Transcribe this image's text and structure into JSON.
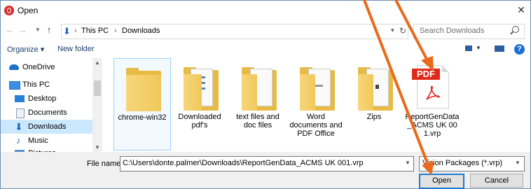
{
  "window": {
    "title": "Open",
    "close_glyph": "✕"
  },
  "nav": {
    "back_glyph": "←",
    "forward_glyph": "→",
    "up_glyph": "↑",
    "breadcrumb": [
      "This PC",
      "Downloads"
    ],
    "breadcrumb_sep": "›",
    "search_placeholder": "Search Downloads"
  },
  "toolbar": {
    "organize": "Organize ▾",
    "new_folder": "New folder",
    "help": "?"
  },
  "sidebar": {
    "items": [
      {
        "label": "OneDrive",
        "icon": "cloud-icon",
        "color": "#1e6fc6"
      },
      {
        "label": "This PC",
        "icon": "computer-icon",
        "color": "#3a8ee6"
      },
      {
        "label": "Desktop",
        "icon": "desktop-icon",
        "color": "#2a7fd6"
      },
      {
        "label": "Documents",
        "icon": "documents-icon",
        "color": "#8b9bb0"
      },
      {
        "label": "Downloads",
        "icon": "download-icon",
        "color": "#1d69c4",
        "selected": true
      },
      {
        "label": "Music",
        "icon": "music-icon",
        "color": "#1e6fc6"
      },
      {
        "label": "Pictures",
        "icon": "pictures-icon",
        "color": "#5a8fd0"
      }
    ]
  },
  "files": [
    {
      "name": "chrome-win32",
      "type": "folder"
    },
    {
      "name": "Downloaded pdf's",
      "type": "folder"
    },
    {
      "name": "text files and doc files",
      "type": "folder"
    },
    {
      "name": "Word documents and PDF Office",
      "type": "folder"
    },
    {
      "name": "Zips",
      "type": "folder"
    },
    {
      "name": "ReportGenData_ACMS UK 001.vrp",
      "type": "pdf",
      "badge": "PDF"
    }
  ],
  "bottom": {
    "file_name_label": "File name:",
    "file_name_value": "C:\\Users\\donte.palmer\\Downloads\\ReportGenData_ACMS UK 001.vrp",
    "file_type_value": "Vision Packages (*.vrp)",
    "open_label": "Open",
    "cancel_label": "Cancel"
  },
  "colors": {
    "accent": "#1f79d1",
    "annotation_arrow": "#ea6a1c",
    "selection": "#cce8ff"
  }
}
